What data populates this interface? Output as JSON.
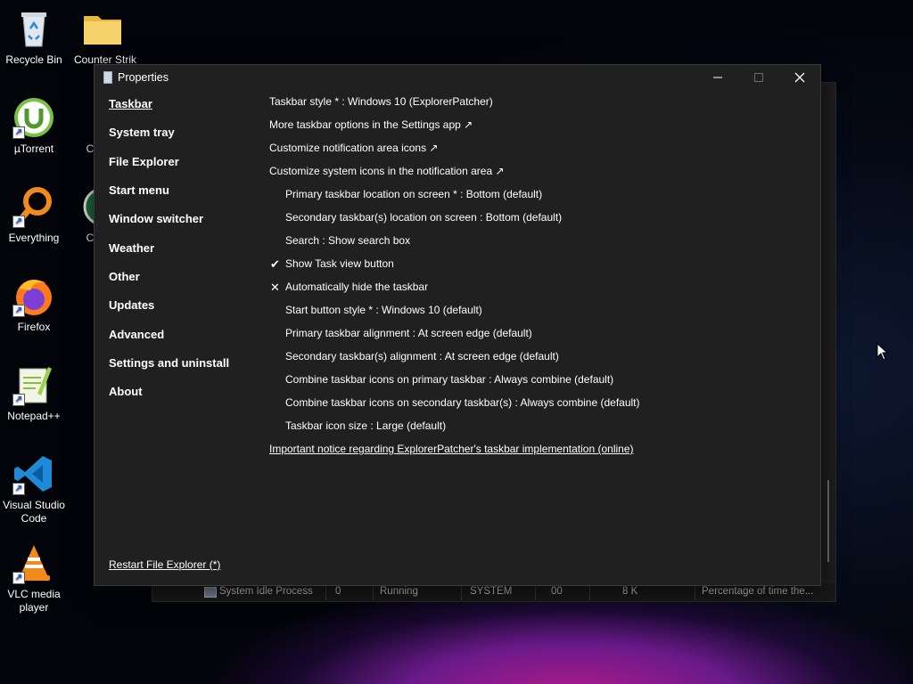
{
  "desktop_icons": [
    {
      "label": "Recycle Bin",
      "icon": "recycle-bin-icon"
    },
    {
      "label": "Counter Strik",
      "icon": "folder-icon"
    },
    {
      "label": "µTorrent",
      "icon": "utorrent-icon"
    },
    {
      "label": "Co Strik",
      "icon": "shortcut-icon"
    },
    {
      "label": "Everything",
      "icon": "everything-search-icon"
    },
    {
      "label": "Co Strik",
      "icon": "shortcut-icon"
    },
    {
      "label": "Firefox",
      "icon": "firefox-icon"
    },
    {
      "label": "Notepad++",
      "icon": "notepadpp-icon"
    },
    {
      "label": "Visual Studio Code",
      "icon": "vscode-icon"
    },
    {
      "label": "VLC media player",
      "icon": "vlc-icon"
    }
  ],
  "task_manager": {
    "process_name": "System Idle Process",
    "pid": "0",
    "status": "Running",
    "user": "SYSTEM",
    "cpu": "00",
    "memory": "8 K",
    "description": "Percentage of time the..."
  },
  "window": {
    "title": "Properties",
    "controls": {
      "minimize": "—",
      "maximize": "☐",
      "close": "✕"
    }
  },
  "nav": [
    {
      "label": "Taskbar",
      "active": true
    },
    {
      "label": "System tray"
    },
    {
      "label": "File Explorer"
    },
    {
      "label": "Start menu"
    },
    {
      "label": "Window switcher"
    },
    {
      "label": "Weather"
    },
    {
      "label": "Other"
    },
    {
      "label": "Updates"
    },
    {
      "label": "Advanced"
    },
    {
      "label": "Settings and uninstall"
    },
    {
      "label": "About"
    }
  ],
  "restart_link": "Restart File Explorer (*)",
  "options": [
    {
      "text": "Taskbar style * : Windows 10 (ExplorerPatcher)",
      "indent": false,
      "mark": ""
    },
    {
      "text": "More taskbar options in the Settings app ↗",
      "indent": false,
      "mark": ""
    },
    {
      "text": "Customize notification area icons ↗",
      "indent": false,
      "mark": ""
    },
    {
      "text": "Customize system icons in the notification area ↗",
      "indent": false,
      "mark": ""
    },
    {
      "text": "Primary taskbar location on screen * : Bottom (default)",
      "indent": true,
      "mark": ""
    },
    {
      "text": "Secondary taskbar(s) location on screen : Bottom (default)",
      "indent": true,
      "mark": ""
    },
    {
      "text": "Search : Show search box",
      "indent": true,
      "mark": ""
    },
    {
      "text": "Show Task view button",
      "indent": true,
      "mark": "✔"
    },
    {
      "text": "Automatically hide the taskbar",
      "indent": true,
      "mark": "✕"
    },
    {
      "text": "Start button style * : Windows 10 (default)",
      "indent": true,
      "mark": ""
    },
    {
      "text": "Primary taskbar alignment : At screen edge (default)",
      "indent": true,
      "mark": ""
    },
    {
      "text": "Secondary taskbar(s) alignment : At screen edge (default)",
      "indent": true,
      "mark": ""
    },
    {
      "text": "Combine taskbar icons on primary taskbar : Always combine (default)",
      "indent": true,
      "mark": ""
    },
    {
      "text": "Combine taskbar icons on secondary taskbar(s) : Always combine (default)",
      "indent": true,
      "mark": ""
    },
    {
      "text": "Taskbar icon size : Large (default)",
      "indent": true,
      "mark": ""
    }
  ],
  "notice_link": "Important notice regarding ExplorerPatcher's taskbar implementation (online)"
}
